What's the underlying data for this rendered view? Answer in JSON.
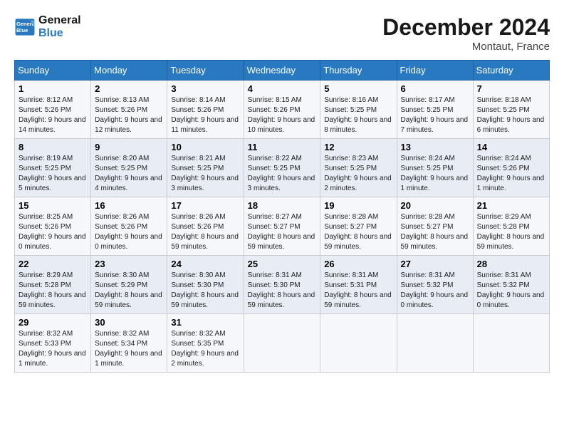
{
  "header": {
    "logo_line1": "General",
    "logo_line2": "Blue",
    "month": "December 2024",
    "location": "Montaut, France"
  },
  "weekdays": [
    "Sunday",
    "Monday",
    "Tuesday",
    "Wednesday",
    "Thursday",
    "Friday",
    "Saturday"
  ],
  "weeks": [
    [
      {
        "day": "1",
        "sunrise": "8:12 AM",
        "sunset": "5:26 PM",
        "daylight": "9 hours and 14 minutes."
      },
      {
        "day": "2",
        "sunrise": "8:13 AM",
        "sunset": "5:26 PM",
        "daylight": "9 hours and 12 minutes."
      },
      {
        "day": "3",
        "sunrise": "8:14 AM",
        "sunset": "5:26 PM",
        "daylight": "9 hours and 11 minutes."
      },
      {
        "day": "4",
        "sunrise": "8:15 AM",
        "sunset": "5:26 PM",
        "daylight": "9 hours and 10 minutes."
      },
      {
        "day": "5",
        "sunrise": "8:16 AM",
        "sunset": "5:25 PM",
        "daylight": "9 hours and 8 minutes."
      },
      {
        "day": "6",
        "sunrise": "8:17 AM",
        "sunset": "5:25 PM",
        "daylight": "9 hours and 7 minutes."
      },
      {
        "day": "7",
        "sunrise": "8:18 AM",
        "sunset": "5:25 PM",
        "daylight": "9 hours and 6 minutes."
      }
    ],
    [
      {
        "day": "8",
        "sunrise": "8:19 AM",
        "sunset": "5:25 PM",
        "daylight": "9 hours and 5 minutes."
      },
      {
        "day": "9",
        "sunrise": "8:20 AM",
        "sunset": "5:25 PM",
        "daylight": "9 hours and 4 minutes."
      },
      {
        "day": "10",
        "sunrise": "8:21 AM",
        "sunset": "5:25 PM",
        "daylight": "9 hours and 3 minutes."
      },
      {
        "day": "11",
        "sunrise": "8:22 AM",
        "sunset": "5:25 PM",
        "daylight": "9 hours and 3 minutes."
      },
      {
        "day": "12",
        "sunrise": "8:23 AM",
        "sunset": "5:25 PM",
        "daylight": "9 hours and 2 minutes."
      },
      {
        "day": "13",
        "sunrise": "8:24 AM",
        "sunset": "5:25 PM",
        "daylight": "9 hours and 1 minute."
      },
      {
        "day": "14",
        "sunrise": "8:24 AM",
        "sunset": "5:26 PM",
        "daylight": "9 hours and 1 minute."
      }
    ],
    [
      {
        "day": "15",
        "sunrise": "8:25 AM",
        "sunset": "5:26 PM",
        "daylight": "9 hours and 0 minutes."
      },
      {
        "day": "16",
        "sunrise": "8:26 AM",
        "sunset": "5:26 PM",
        "daylight": "9 hours and 0 minutes."
      },
      {
        "day": "17",
        "sunrise": "8:26 AM",
        "sunset": "5:26 PM",
        "daylight": "8 hours and 59 minutes."
      },
      {
        "day": "18",
        "sunrise": "8:27 AM",
        "sunset": "5:27 PM",
        "daylight": "8 hours and 59 minutes."
      },
      {
        "day": "19",
        "sunrise": "8:28 AM",
        "sunset": "5:27 PM",
        "daylight": "8 hours and 59 minutes."
      },
      {
        "day": "20",
        "sunrise": "8:28 AM",
        "sunset": "5:27 PM",
        "daylight": "8 hours and 59 minutes."
      },
      {
        "day": "21",
        "sunrise": "8:29 AM",
        "sunset": "5:28 PM",
        "daylight": "8 hours and 59 minutes."
      }
    ],
    [
      {
        "day": "22",
        "sunrise": "8:29 AM",
        "sunset": "5:28 PM",
        "daylight": "8 hours and 59 minutes."
      },
      {
        "day": "23",
        "sunrise": "8:30 AM",
        "sunset": "5:29 PM",
        "daylight": "8 hours and 59 minutes."
      },
      {
        "day": "24",
        "sunrise": "8:30 AM",
        "sunset": "5:30 PM",
        "daylight": "8 hours and 59 minutes."
      },
      {
        "day": "25",
        "sunrise": "8:31 AM",
        "sunset": "5:30 PM",
        "daylight": "8 hours and 59 minutes."
      },
      {
        "day": "26",
        "sunrise": "8:31 AM",
        "sunset": "5:31 PM",
        "daylight": "8 hours and 59 minutes."
      },
      {
        "day": "27",
        "sunrise": "8:31 AM",
        "sunset": "5:32 PM",
        "daylight": "9 hours and 0 minutes."
      },
      {
        "day": "28",
        "sunrise": "8:31 AM",
        "sunset": "5:32 PM",
        "daylight": "9 hours and 0 minutes."
      }
    ],
    [
      {
        "day": "29",
        "sunrise": "8:32 AM",
        "sunset": "5:33 PM",
        "daylight": "9 hours and 1 minute."
      },
      {
        "day": "30",
        "sunrise": "8:32 AM",
        "sunset": "5:34 PM",
        "daylight": "9 hours and 1 minute."
      },
      {
        "day": "31",
        "sunrise": "8:32 AM",
        "sunset": "5:35 PM",
        "daylight": "9 hours and 2 minutes."
      },
      null,
      null,
      null,
      null
    ]
  ],
  "labels": {
    "sunrise": "Sunrise:",
    "sunset": "Sunset:",
    "daylight": "Daylight:"
  }
}
